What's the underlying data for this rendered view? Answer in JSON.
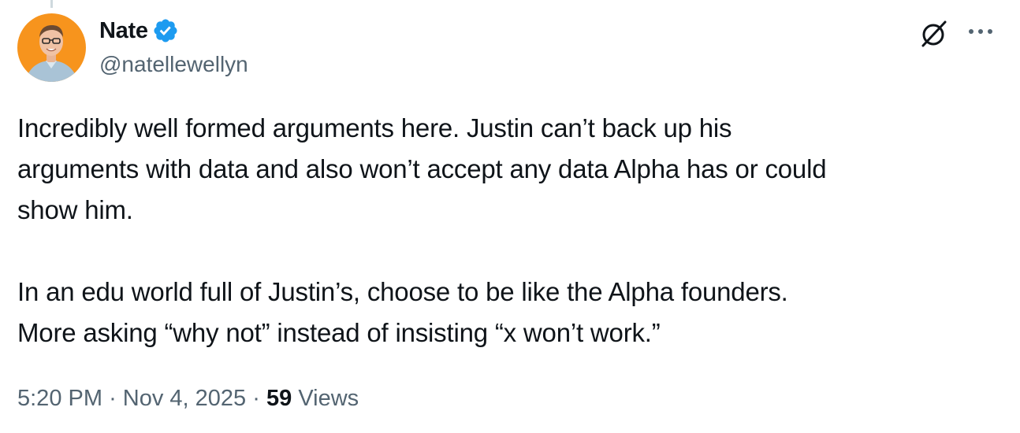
{
  "author": {
    "display_name": "Nate",
    "handle": "@natellewellyn",
    "verified": true,
    "avatar_icon": "person-portrait-avatar",
    "avatar_bg": "#f7941d"
  },
  "header_actions": {
    "grok_icon": "grok-slash-circle-icon",
    "more_icon": "more-horizontal-icon"
  },
  "tweet": {
    "paragraphs": [
      {
        "lines": [
          "Incredibly well formed arguments here. Justin can’t back up his",
          "arguments with data and also won’t accept any data Alpha has or could",
          "show him."
        ]
      },
      {
        "lines": [
          "In an edu world full of Justin’s, choose to be like the Alpha founders.",
          "More asking “why not” instead of insisting “x won’t work.”"
        ]
      }
    ]
  },
  "meta": {
    "time": "5:20 PM",
    "separator": "·",
    "date": "Nov 4, 2025",
    "views_count": "59",
    "views_label": "Views"
  },
  "colors": {
    "text_primary": "#0f1419",
    "text_secondary": "#536471",
    "verified_blue": "#1d9bf0"
  }
}
